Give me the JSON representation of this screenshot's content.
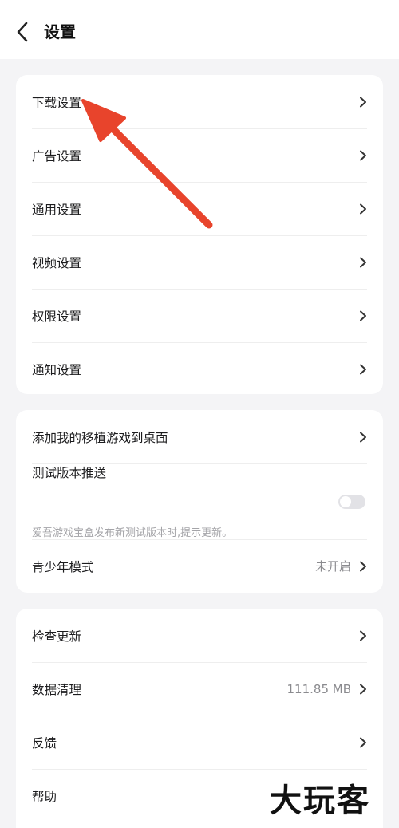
{
  "header": {
    "title": "设置",
    "back_icon": "back-arrow-icon"
  },
  "group1": {
    "items": [
      {
        "label": "下载设置"
      },
      {
        "label": "广告设置"
      },
      {
        "label": "通用设置"
      },
      {
        "label": "视频设置"
      },
      {
        "label": "权限设置"
      },
      {
        "label": "通知设置"
      }
    ]
  },
  "group2": {
    "desktop_shortcut_label": "添加我的移植游戏到桌面",
    "test_push_label": "测试版本推送",
    "test_push_desc": "爱吾游戏宝盒发布新测试版本时,提示更新。",
    "test_push_enabled": false,
    "teen_mode_label": "青少年模式",
    "teen_mode_value": "未开启"
  },
  "group3": {
    "check_update_label": "检查更新",
    "data_clean_label": "数据清理",
    "data_clean_value": "111.85 MB",
    "feedback_label": "反馈",
    "help_label": "帮助"
  },
  "annotation": {
    "type": "arrow",
    "color": "#e8442c",
    "points_to": "下载设置"
  },
  "watermark": {
    "text": "大玩客"
  },
  "colors": {
    "background": "#f4f4f6",
    "card": "#ffffff",
    "text_primary": "#1c1c1e",
    "text_secondary": "#8a8a8e",
    "toggle_off": "#e2e2e6"
  }
}
